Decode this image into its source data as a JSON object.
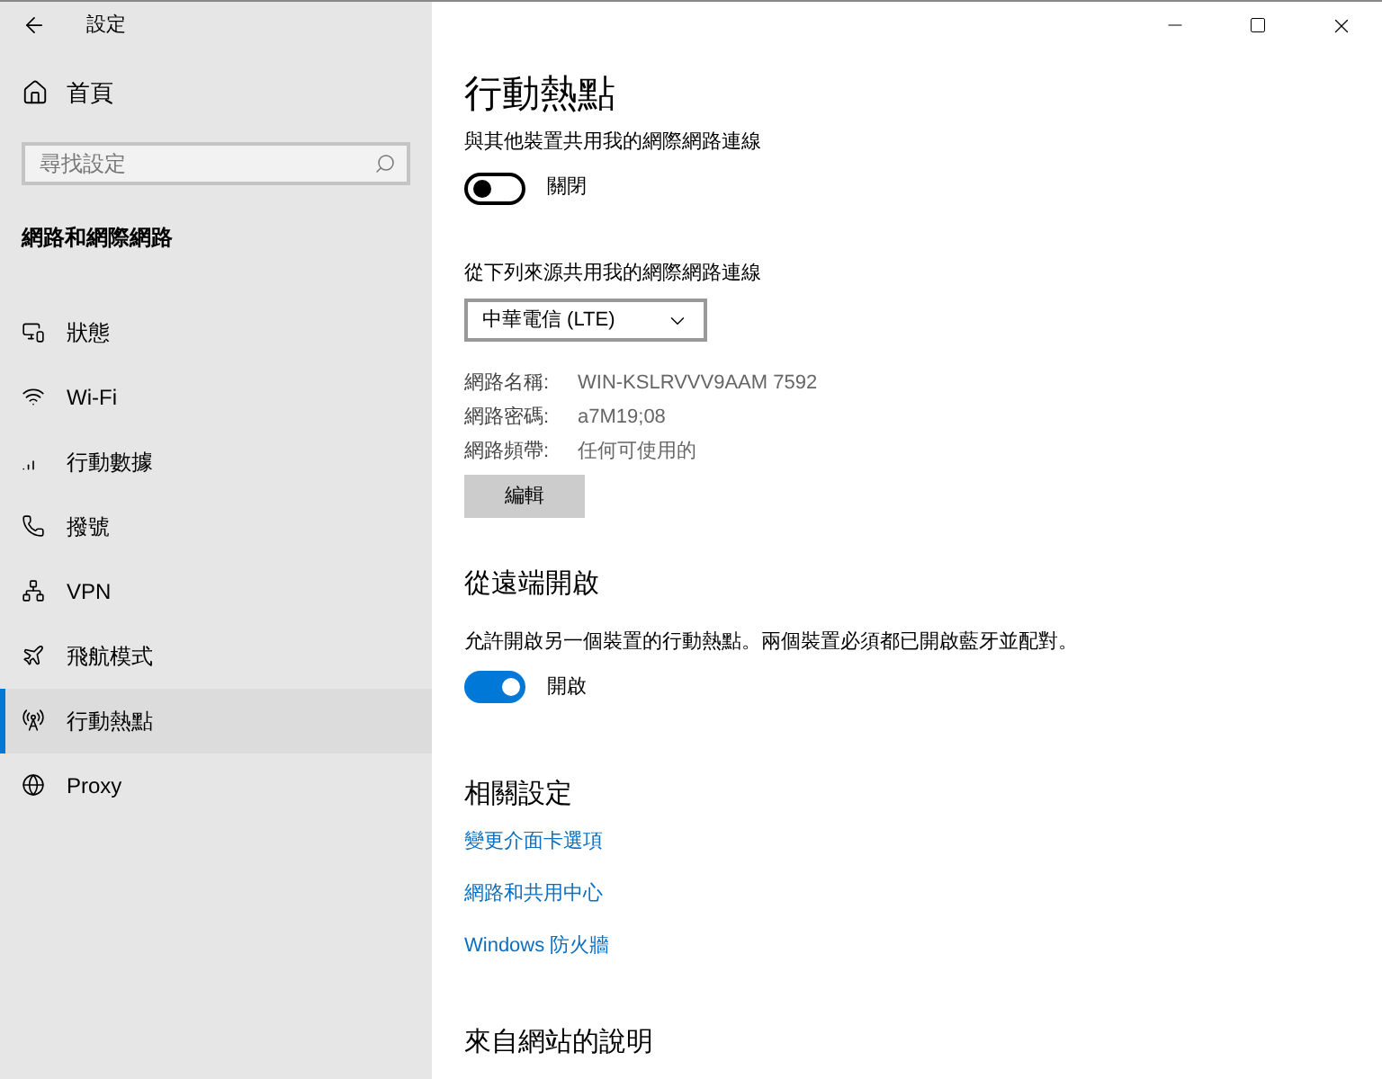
{
  "window": {
    "title": "設定"
  },
  "sidebar": {
    "home": "首頁",
    "search": {
      "placeholder": "尋找設定"
    },
    "section": "網路和網際網路",
    "items": [
      {
        "label": "狀態",
        "selected": false
      },
      {
        "label": "Wi-Fi",
        "selected": false
      },
      {
        "label": "行動數據",
        "selected": false
      },
      {
        "label": "撥號",
        "selected": false
      },
      {
        "label": "VPN",
        "selected": false
      },
      {
        "label": "飛航模式",
        "selected": false
      },
      {
        "label": "行動熱點",
        "selected": true
      },
      {
        "label": "Proxy",
        "selected": false
      }
    ]
  },
  "page": {
    "title": "行動熱點",
    "share": {
      "label": "與其他裝置共用我的網際網路連線",
      "on": false,
      "state": "關閉"
    },
    "source": {
      "label": "從下列來源共用我的網際網路連線",
      "value": "中華電信 (LTE)"
    },
    "details": [
      {
        "name": "網路名稱:",
        "value": "WIN-KSLRVVV9AAM 7592"
      },
      {
        "name": "網路密碼:",
        "value": "a7M19;08"
      },
      {
        "name": "網路頻帶:",
        "value": "任何可使用的"
      }
    ],
    "edit_button": "編輯",
    "remote": {
      "heading": "從遠端開啟",
      "description": "允許開啟另一個裝置的行動熱點。兩個裝置必須都已開啟藍牙並配對。",
      "on": true,
      "state": "開啟"
    },
    "related": {
      "heading": "相關設定",
      "links": [
        "變更介面卡選項",
        "網路和共用中心",
        "Windows 防火牆"
      ]
    },
    "help": {
      "heading": "來自網站的說明"
    }
  }
}
